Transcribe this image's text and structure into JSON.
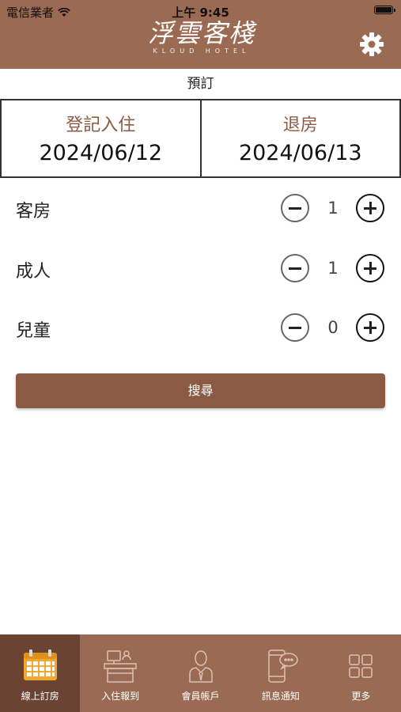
{
  "status_bar": {
    "carrier": "電信業者",
    "time": "上午 9:45"
  },
  "header": {
    "logo_text": "浮雲客棧",
    "logo_sub": "KLOUD HOTEL"
  },
  "page_title": "預訂",
  "dates": {
    "checkin_label": "登記入住",
    "checkin_value": "2024/06/12",
    "checkout_label": "退房",
    "checkout_value": "2024/06/13"
  },
  "counters": [
    {
      "label": "客房",
      "value": "1"
    },
    {
      "label": "成人",
      "value": "1"
    },
    {
      "label": "兒童",
      "value": "0"
    }
  ],
  "search_label": "搜尋",
  "tabs": [
    {
      "label": "線上訂房",
      "icon": "calendar-icon",
      "active": true
    },
    {
      "label": "入住報到",
      "icon": "reception-desk-icon",
      "active": false
    },
    {
      "label": "會員帳戶",
      "icon": "member-icon",
      "active": false
    },
    {
      "label": "訊息通知",
      "icon": "phone-message-icon",
      "active": false
    },
    {
      "label": "更多",
      "icon": "grid-icon",
      "active": false
    }
  ],
  "colors": {
    "header_bg": "#9a6a52",
    "accent_text": "#8c5a42",
    "button_bg": "#8b5a44",
    "active_tab_bg": "#6a4333",
    "calendar_icon": "#f0a830"
  }
}
